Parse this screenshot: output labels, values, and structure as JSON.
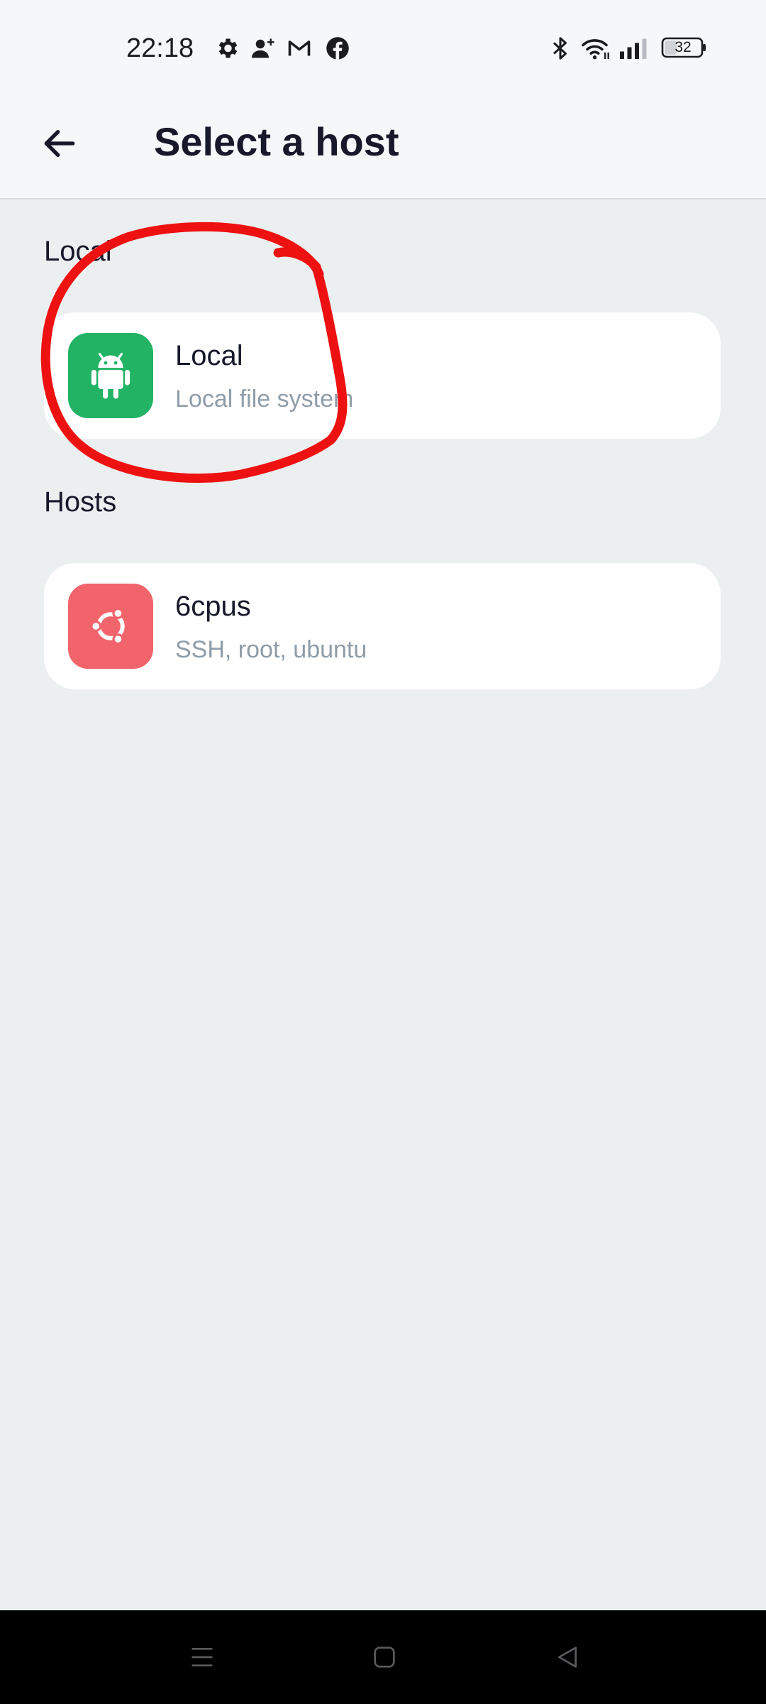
{
  "status_bar": {
    "time": "22:18",
    "notification_icons": [
      "settings-icon",
      "person-add-icon",
      "gmail-icon",
      "facebook-icon"
    ],
    "system_icons": [
      "bluetooth-icon",
      "wifi-icon",
      "cellular-signal-icon",
      "battery-icon"
    ],
    "battery_level": "32"
  },
  "app_bar": {
    "back_icon": "arrow-left-icon",
    "title": "Select a host"
  },
  "sections": {
    "local": {
      "label": "Local",
      "items": [
        {
          "title": "Local",
          "subtitle": "Local file system",
          "icon": "android-icon",
          "icon_color": "#22B365"
        }
      ]
    },
    "hosts": {
      "label": "Hosts",
      "items": [
        {
          "title": "6cpus",
          "subtitle": "SSH, root, ubuntu",
          "icon": "ubuntu-icon",
          "icon_color": "#F2646B"
        }
      ]
    }
  },
  "annotation": {
    "shape": "hand-drawn-circle",
    "color": "#EE1111"
  },
  "nav_bar": {
    "buttons": [
      "menu-icon",
      "home-icon",
      "back-triangle-icon"
    ]
  },
  "colors": {
    "background": "#ECEFF0",
    "app_bar": "#F6F7F9",
    "card": "#FFFFFF",
    "text_primary": "#17192B",
    "text_secondary": "#8F9CA8"
  }
}
